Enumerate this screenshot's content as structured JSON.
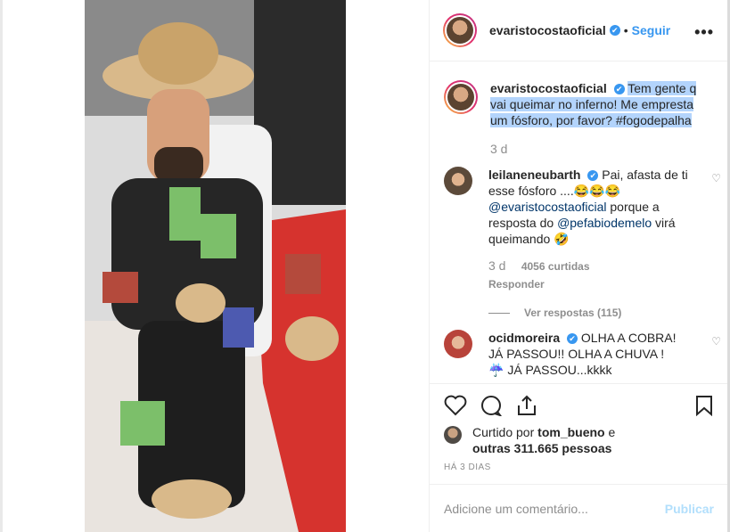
{
  "post": {
    "author": "evaristocostaoficial",
    "follow_label": "Seguir",
    "more_label": "•••",
    "dot": "•"
  },
  "caption": {
    "username": "evaristocostaoficial",
    "text": "Tem gente q vai queimar no inferno! Me empresta um fósforo, por favor? #fogodepalha",
    "time": "3 d"
  },
  "comments": [
    {
      "username": "leilaneneubarth",
      "text_a": "Pai, afasta de ti esse fósforo ....😂😂😂",
      "mention_a": "@evaristocostaoficial",
      "text_b": "porque a resposta do",
      "mention_b": "@pefabiodemelo",
      "text_c": "virá queimando 🤣",
      "time": "3 d",
      "likes": "4056 curtidas",
      "reply": "Responder",
      "view_replies": "Ver respostas (115)"
    },
    {
      "username": "ocidmoreira",
      "text": "OLHA A COBRA! JÁ PASSOU!! OLHA A CHUVA ! ☔️ JÁ PASSOU...kkkk"
    }
  ],
  "likes": {
    "prefix": "Curtido por",
    "user": "tom_bueno",
    "middle": "e",
    "others": "outras 311.665 pessoas"
  },
  "posted": "HÁ 3 DIAS",
  "comment_box": {
    "placeholder": "Adicione um comentário...",
    "publish": "Publicar"
  },
  "icons": {
    "verified": "✔",
    "heart": "♡",
    "comment": "◯",
    "share": "⇪",
    "bookmark": "⚑"
  },
  "colors": {
    "accent": "#3897f0",
    "highlight": "#b3d4fc",
    "publish_disabled": "#b2dffc"
  }
}
